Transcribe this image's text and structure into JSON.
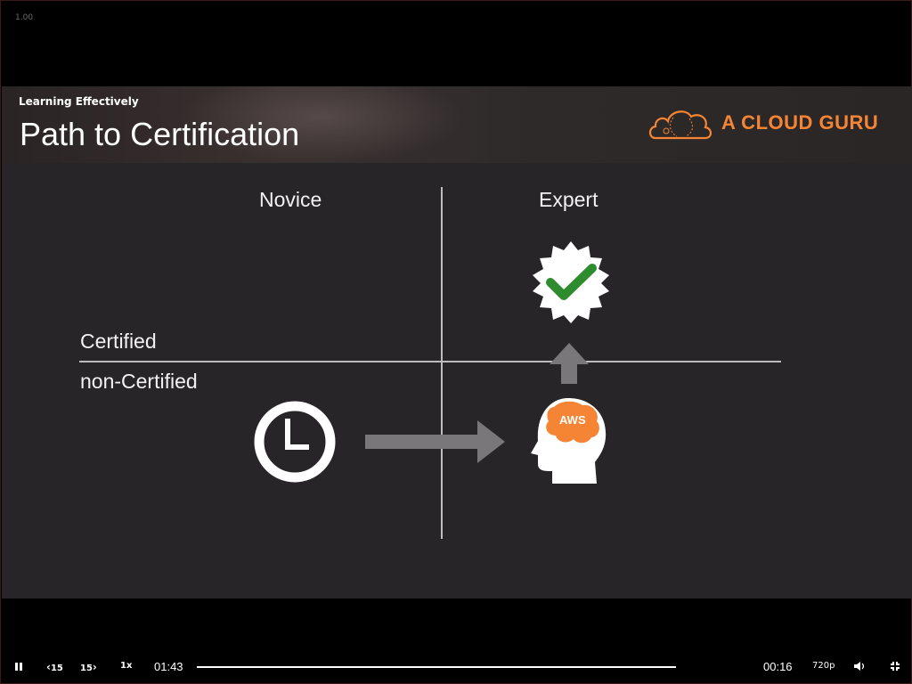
{
  "player": {
    "speed_overlay": "1.00",
    "controls": {
      "play_pause_icon": "pause-icon",
      "rewind_label": "15",
      "forward_label": "15",
      "speed_label": "1x",
      "elapsed": "01:43",
      "remaining": "00:16",
      "quality": "720p",
      "volume_icon": "volume-icon",
      "fullscreen_icon": "exit-fullscreen-icon",
      "progress": 1.0
    }
  },
  "slide": {
    "eyebrow": "Learning Effectively",
    "title": "Path to Certification",
    "logo_text": "A CLOUD GURU",
    "columns": [
      "Novice",
      "Expert"
    ],
    "rows": [
      "Certified",
      "non-Certified"
    ],
    "badge_text": "AWS",
    "colors": {
      "accent": "#f58534",
      "check_green": "#2e8b2e",
      "arrow_gray": "#7a777a"
    }
  }
}
